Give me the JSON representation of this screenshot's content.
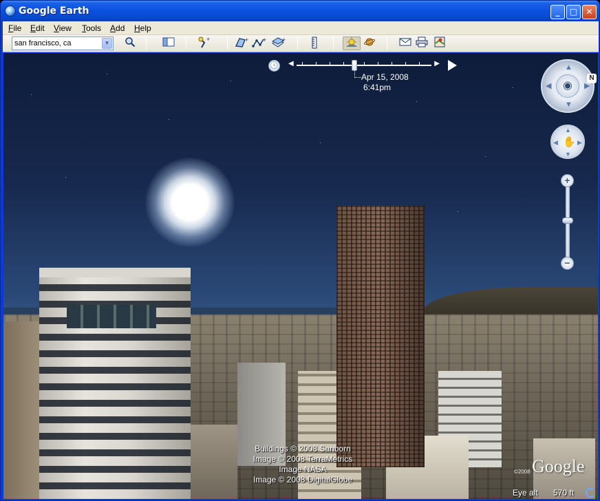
{
  "window": {
    "title": "Google Earth",
    "minimize_glyph": "_",
    "maximize_glyph": "□",
    "close_glyph": "✕"
  },
  "menu": {
    "items": [
      {
        "label": "File",
        "accel": "F",
        "rest": "ile"
      },
      {
        "label": "Edit",
        "accel": "E",
        "rest": "dit"
      },
      {
        "label": "View",
        "accel": "V",
        "rest": "iew"
      },
      {
        "label": "Tools",
        "accel": "T",
        "rest": "ools"
      },
      {
        "label": "Add",
        "accel": "A",
        "rest": "dd"
      },
      {
        "label": "Help",
        "accel": "H",
        "rest": "elp"
      }
    ]
  },
  "toolbar": {
    "search_value": "san francisco, ca",
    "dropdown_glyph": "▼",
    "search_glyph": "🔍",
    "icons": [
      "sidebar-icon",
      "placemark-icon",
      "polygon-icon",
      "path-icon",
      "image-overlay-icon",
      "ruler-icon",
      "sun-icon",
      "planets-icon",
      "email-icon",
      "print-icon",
      "view-in-maps-icon"
    ]
  },
  "time_slider": {
    "date": "Apr 15, 2008",
    "time": "6:41pm",
    "clock_glyph": "🕓",
    "left_glyph": "◀",
    "right_glyph": "▶"
  },
  "navigation": {
    "north_label": "N",
    "look_glyph": "◉",
    "move_glyph": "✋",
    "zoom_in_glyph": "+",
    "zoom_out_glyph": "−",
    "zoom_level": 0.47
  },
  "attribution": {
    "lines": [
      "Buildings © 2008 Sanborn",
      "Image © 2008 TerraMetrics",
      "Image NASA",
      "Image © 2008 DigitalGlobe"
    ],
    "logo_text": "Google",
    "logo_copyright": "©2008"
  },
  "status": {
    "eye_alt_label": "Eye alt",
    "eye_alt_value": "570 ft"
  },
  "colors": {
    "titlebar": "#0a50e0",
    "chrome": "#ece9d8",
    "sky_top": "#0e1c3a"
  }
}
